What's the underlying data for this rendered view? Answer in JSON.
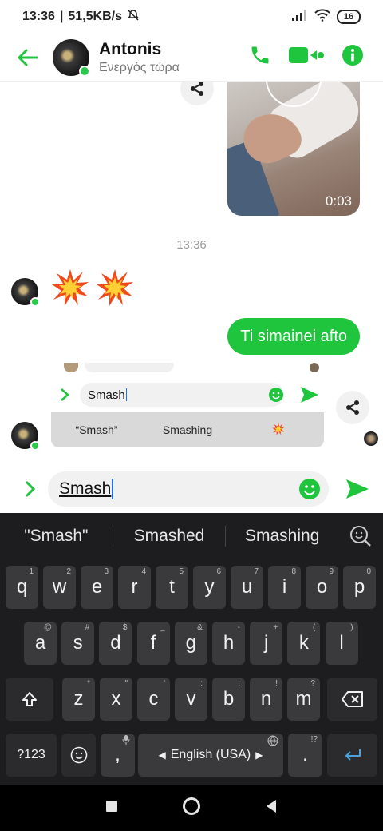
{
  "status_bar": {
    "time": "13:36",
    "net_speed": "51,5KB/s",
    "battery": "16"
  },
  "header": {
    "contact_name": "Antonis",
    "contact_status": "Ενεργός τώρα"
  },
  "chat": {
    "video_duration": "0:03",
    "timestamp": "13:36",
    "sent_message": "Ti simainei afto"
  },
  "ghost_popup": {
    "input_text": "Smash",
    "suggestions": [
      "“Smash”",
      "Smashing"
    ]
  },
  "composer": {
    "input_text": "Smash"
  },
  "keyboard": {
    "suggestions": [
      "\"Smash\"",
      "Smashed",
      "Smashing"
    ],
    "row1": [
      {
        "k": "q",
        "h": "1"
      },
      {
        "k": "w",
        "h": "2"
      },
      {
        "k": "e",
        "h": "3"
      },
      {
        "k": "r",
        "h": "4"
      },
      {
        "k": "t",
        "h": "5"
      },
      {
        "k": "y",
        "h": "6"
      },
      {
        "k": "u",
        "h": "7"
      },
      {
        "k": "i",
        "h": "8"
      },
      {
        "k": "o",
        "h": "9"
      },
      {
        "k": "p",
        "h": "0"
      }
    ],
    "row2": [
      {
        "k": "a",
        "h": "@"
      },
      {
        "k": "s",
        "h": "#"
      },
      {
        "k": "d",
        "h": "$"
      },
      {
        "k": "f",
        "h": "_"
      },
      {
        "k": "g",
        "h": "&"
      },
      {
        "k": "h",
        "h": "-"
      },
      {
        "k": "j",
        "h": "+"
      },
      {
        "k": "k",
        "h": "("
      },
      {
        "k": "l",
        "h": ")"
      }
    ],
    "row3": [
      {
        "k": "z",
        "h": "*"
      },
      {
        "k": "x",
        "h": "\""
      },
      {
        "k": "c",
        "h": "'"
      },
      {
        "k": "v",
        "h": ":"
      },
      {
        "k": "b",
        "h": ";"
      },
      {
        "k": "n",
        "h": "!"
      },
      {
        "k": "m",
        "h": "?"
      }
    ],
    "symbols_label": "?123",
    "comma": ",",
    "space_label": "English (USA)",
    "period": ".",
    "period_hint": "!?"
  }
}
